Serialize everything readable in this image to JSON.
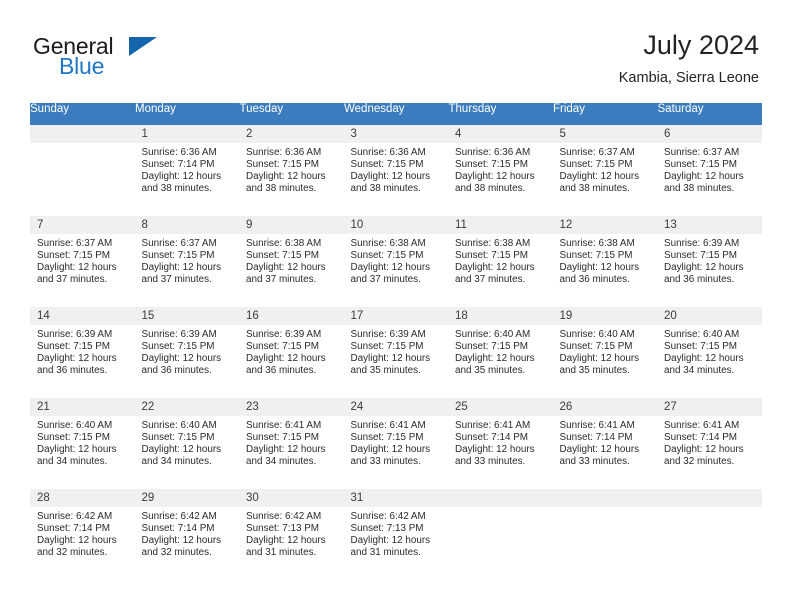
{
  "brand": {
    "word1": "General",
    "word2": "Blue",
    "triangle_color": "#1565ad",
    "blue_color": "#1f77c4"
  },
  "header": {
    "title": "July 2024",
    "subtitle": "Kambia, Sierra Leone"
  },
  "calendar": {
    "header_bg": "#3a7cbe",
    "daynum_bg": "#f0f0f0",
    "weekday_headers": [
      "Sunday",
      "Monday",
      "Tuesday",
      "Wednesday",
      "Thursday",
      "Friday",
      "Saturday"
    ],
    "weeks": [
      [
        {
          "day": "",
          "sunrise": "",
          "sunset": "",
          "daylight1": "",
          "daylight2": ""
        },
        {
          "day": "1",
          "sunrise": "Sunrise: 6:36 AM",
          "sunset": "Sunset: 7:14 PM",
          "daylight1": "Daylight: 12 hours",
          "daylight2": "and 38 minutes."
        },
        {
          "day": "2",
          "sunrise": "Sunrise: 6:36 AM",
          "sunset": "Sunset: 7:15 PM",
          "daylight1": "Daylight: 12 hours",
          "daylight2": "and 38 minutes."
        },
        {
          "day": "3",
          "sunrise": "Sunrise: 6:36 AM",
          "sunset": "Sunset: 7:15 PM",
          "daylight1": "Daylight: 12 hours",
          "daylight2": "and 38 minutes."
        },
        {
          "day": "4",
          "sunrise": "Sunrise: 6:36 AM",
          "sunset": "Sunset: 7:15 PM",
          "daylight1": "Daylight: 12 hours",
          "daylight2": "and 38 minutes."
        },
        {
          "day": "5",
          "sunrise": "Sunrise: 6:37 AM",
          "sunset": "Sunset: 7:15 PM",
          "daylight1": "Daylight: 12 hours",
          "daylight2": "and 38 minutes."
        },
        {
          "day": "6",
          "sunrise": "Sunrise: 6:37 AM",
          "sunset": "Sunset: 7:15 PM",
          "daylight1": "Daylight: 12 hours",
          "daylight2": "and 38 minutes."
        }
      ],
      [
        {
          "day": "7",
          "sunrise": "Sunrise: 6:37 AM",
          "sunset": "Sunset: 7:15 PM",
          "daylight1": "Daylight: 12 hours",
          "daylight2": "and 37 minutes."
        },
        {
          "day": "8",
          "sunrise": "Sunrise: 6:37 AM",
          "sunset": "Sunset: 7:15 PM",
          "daylight1": "Daylight: 12 hours",
          "daylight2": "and 37 minutes."
        },
        {
          "day": "9",
          "sunrise": "Sunrise: 6:38 AM",
          "sunset": "Sunset: 7:15 PM",
          "daylight1": "Daylight: 12 hours",
          "daylight2": "and 37 minutes."
        },
        {
          "day": "10",
          "sunrise": "Sunrise: 6:38 AM",
          "sunset": "Sunset: 7:15 PM",
          "daylight1": "Daylight: 12 hours",
          "daylight2": "and 37 minutes."
        },
        {
          "day": "11",
          "sunrise": "Sunrise: 6:38 AM",
          "sunset": "Sunset: 7:15 PM",
          "daylight1": "Daylight: 12 hours",
          "daylight2": "and 37 minutes."
        },
        {
          "day": "12",
          "sunrise": "Sunrise: 6:38 AM",
          "sunset": "Sunset: 7:15 PM",
          "daylight1": "Daylight: 12 hours",
          "daylight2": "and 36 minutes."
        },
        {
          "day": "13",
          "sunrise": "Sunrise: 6:39 AM",
          "sunset": "Sunset: 7:15 PM",
          "daylight1": "Daylight: 12 hours",
          "daylight2": "and 36 minutes."
        }
      ],
      [
        {
          "day": "14",
          "sunrise": "Sunrise: 6:39 AM",
          "sunset": "Sunset: 7:15 PM",
          "daylight1": "Daylight: 12 hours",
          "daylight2": "and 36 minutes."
        },
        {
          "day": "15",
          "sunrise": "Sunrise: 6:39 AM",
          "sunset": "Sunset: 7:15 PM",
          "daylight1": "Daylight: 12 hours",
          "daylight2": "and 36 minutes."
        },
        {
          "day": "16",
          "sunrise": "Sunrise: 6:39 AM",
          "sunset": "Sunset: 7:15 PM",
          "daylight1": "Daylight: 12 hours",
          "daylight2": "and 36 minutes."
        },
        {
          "day": "17",
          "sunrise": "Sunrise: 6:39 AM",
          "sunset": "Sunset: 7:15 PM",
          "daylight1": "Daylight: 12 hours",
          "daylight2": "and 35 minutes."
        },
        {
          "day": "18",
          "sunrise": "Sunrise: 6:40 AM",
          "sunset": "Sunset: 7:15 PM",
          "daylight1": "Daylight: 12 hours",
          "daylight2": "and 35 minutes."
        },
        {
          "day": "19",
          "sunrise": "Sunrise: 6:40 AM",
          "sunset": "Sunset: 7:15 PM",
          "daylight1": "Daylight: 12 hours",
          "daylight2": "and 35 minutes."
        },
        {
          "day": "20",
          "sunrise": "Sunrise: 6:40 AM",
          "sunset": "Sunset: 7:15 PM",
          "daylight1": "Daylight: 12 hours",
          "daylight2": "and 34 minutes."
        }
      ],
      [
        {
          "day": "21",
          "sunrise": "Sunrise: 6:40 AM",
          "sunset": "Sunset: 7:15 PM",
          "daylight1": "Daylight: 12 hours",
          "daylight2": "and 34 minutes."
        },
        {
          "day": "22",
          "sunrise": "Sunrise: 6:40 AM",
          "sunset": "Sunset: 7:15 PM",
          "daylight1": "Daylight: 12 hours",
          "daylight2": "and 34 minutes."
        },
        {
          "day": "23",
          "sunrise": "Sunrise: 6:41 AM",
          "sunset": "Sunset: 7:15 PM",
          "daylight1": "Daylight: 12 hours",
          "daylight2": "and 34 minutes."
        },
        {
          "day": "24",
          "sunrise": "Sunrise: 6:41 AM",
          "sunset": "Sunset: 7:15 PM",
          "daylight1": "Daylight: 12 hours",
          "daylight2": "and 33 minutes."
        },
        {
          "day": "25",
          "sunrise": "Sunrise: 6:41 AM",
          "sunset": "Sunset: 7:14 PM",
          "daylight1": "Daylight: 12 hours",
          "daylight2": "and 33 minutes."
        },
        {
          "day": "26",
          "sunrise": "Sunrise: 6:41 AM",
          "sunset": "Sunset: 7:14 PM",
          "daylight1": "Daylight: 12 hours",
          "daylight2": "and 33 minutes."
        },
        {
          "day": "27",
          "sunrise": "Sunrise: 6:41 AM",
          "sunset": "Sunset: 7:14 PM",
          "daylight1": "Daylight: 12 hours",
          "daylight2": "and 32 minutes."
        }
      ],
      [
        {
          "day": "28",
          "sunrise": "Sunrise: 6:42 AM",
          "sunset": "Sunset: 7:14 PM",
          "daylight1": "Daylight: 12 hours",
          "daylight2": "and 32 minutes."
        },
        {
          "day": "29",
          "sunrise": "Sunrise: 6:42 AM",
          "sunset": "Sunset: 7:14 PM",
          "daylight1": "Daylight: 12 hours",
          "daylight2": "and 32 minutes."
        },
        {
          "day": "30",
          "sunrise": "Sunrise: 6:42 AM",
          "sunset": "Sunset: 7:13 PM",
          "daylight1": "Daylight: 12 hours",
          "daylight2": "and 31 minutes."
        },
        {
          "day": "31",
          "sunrise": "Sunrise: 6:42 AM",
          "sunset": "Sunset: 7:13 PM",
          "daylight1": "Daylight: 12 hours",
          "daylight2": "and 31 minutes."
        },
        {
          "day": "",
          "sunrise": "",
          "sunset": "",
          "daylight1": "",
          "daylight2": ""
        },
        {
          "day": "",
          "sunrise": "",
          "sunset": "",
          "daylight1": "",
          "daylight2": ""
        },
        {
          "day": "",
          "sunrise": "",
          "sunset": "",
          "daylight1": "",
          "daylight2": ""
        }
      ]
    ]
  }
}
